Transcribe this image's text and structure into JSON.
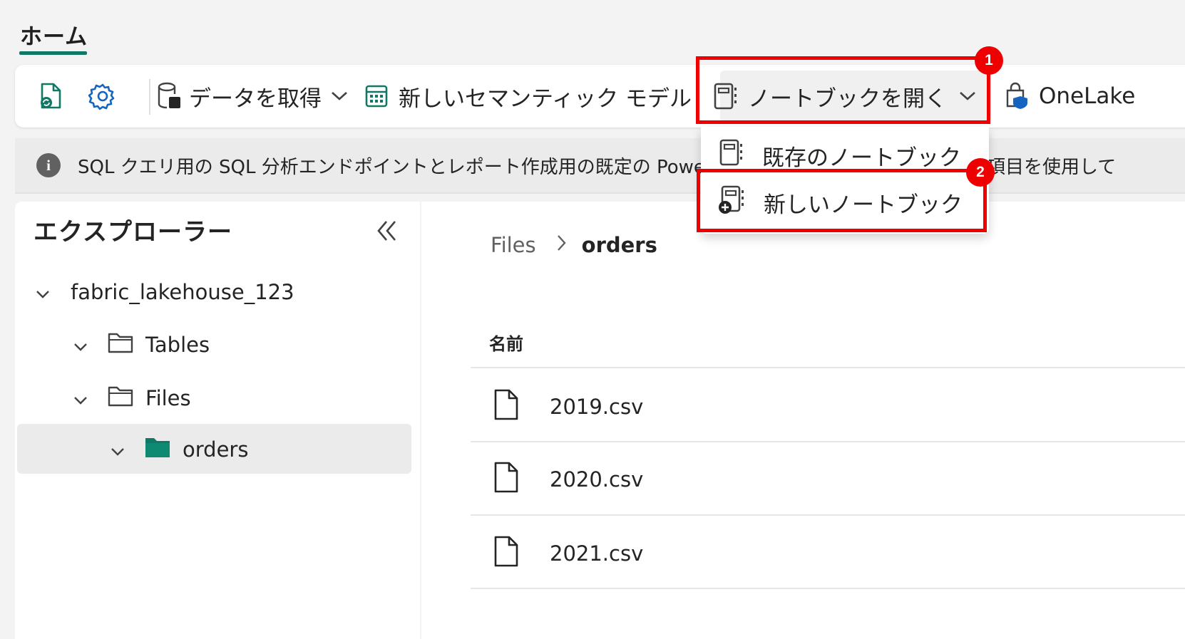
{
  "header": {
    "tab_label": "ホーム"
  },
  "toolbar": {
    "refresh_icon": "refresh-file-icon",
    "settings_icon": "gear-icon",
    "get_data_label": "データを取得",
    "new_semantic_model_label": "新しいセマンティック モデル",
    "open_notebook_label": "ノートブックを開く",
    "onelake_label": "OneLake"
  },
  "info_bar": {
    "text_left": "SQL クエリ用の SQL 分析エンドポイントとレポート作成用の既定の Power",
    "text_right": "項目を使用して"
  },
  "explorer": {
    "title": "エクスプローラー",
    "tree": {
      "root": "fabric_lakehouse_123",
      "tables": "Tables",
      "files": "Files",
      "orders": "orders"
    }
  },
  "content": {
    "breadcrumb": [
      "Files",
      "orders"
    ],
    "column_name": "名前",
    "files": [
      "2019.csv",
      "2020.csv",
      "2021.csv"
    ]
  },
  "open_notebook_menu": {
    "items": [
      "既存のノートブック",
      "新しいノートブック"
    ]
  },
  "annotations": {
    "badge1": "1",
    "badge2": "2",
    "highlight_color": "#ee0000"
  },
  "colors": {
    "accent": "#117865",
    "folder_active": "#117865"
  }
}
